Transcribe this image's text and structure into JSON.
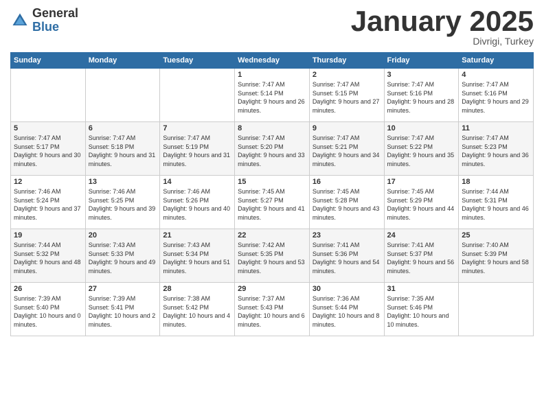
{
  "logo": {
    "general": "General",
    "blue": "Blue"
  },
  "header": {
    "title": "January 2025",
    "location": "Divrigi, Turkey"
  },
  "weekdays": [
    "Sunday",
    "Monday",
    "Tuesday",
    "Wednesday",
    "Thursday",
    "Friday",
    "Saturday"
  ],
  "weeks": [
    [
      {
        "day": "",
        "sunrise": "",
        "sunset": "",
        "daylight": ""
      },
      {
        "day": "",
        "sunrise": "",
        "sunset": "",
        "daylight": ""
      },
      {
        "day": "",
        "sunrise": "",
        "sunset": "",
        "daylight": ""
      },
      {
        "day": "1",
        "sunrise": "Sunrise: 7:47 AM",
        "sunset": "Sunset: 5:14 PM",
        "daylight": "Daylight: 9 hours and 26 minutes."
      },
      {
        "day": "2",
        "sunrise": "Sunrise: 7:47 AM",
        "sunset": "Sunset: 5:15 PM",
        "daylight": "Daylight: 9 hours and 27 minutes."
      },
      {
        "day": "3",
        "sunrise": "Sunrise: 7:47 AM",
        "sunset": "Sunset: 5:16 PM",
        "daylight": "Daylight: 9 hours and 28 minutes."
      },
      {
        "day": "4",
        "sunrise": "Sunrise: 7:47 AM",
        "sunset": "Sunset: 5:16 PM",
        "daylight": "Daylight: 9 hours and 29 minutes."
      }
    ],
    [
      {
        "day": "5",
        "sunrise": "Sunrise: 7:47 AM",
        "sunset": "Sunset: 5:17 PM",
        "daylight": "Daylight: 9 hours and 30 minutes."
      },
      {
        "day": "6",
        "sunrise": "Sunrise: 7:47 AM",
        "sunset": "Sunset: 5:18 PM",
        "daylight": "Daylight: 9 hours and 31 minutes."
      },
      {
        "day": "7",
        "sunrise": "Sunrise: 7:47 AM",
        "sunset": "Sunset: 5:19 PM",
        "daylight": "Daylight: 9 hours and 31 minutes."
      },
      {
        "day": "8",
        "sunrise": "Sunrise: 7:47 AM",
        "sunset": "Sunset: 5:20 PM",
        "daylight": "Daylight: 9 hours and 33 minutes."
      },
      {
        "day": "9",
        "sunrise": "Sunrise: 7:47 AM",
        "sunset": "Sunset: 5:21 PM",
        "daylight": "Daylight: 9 hours and 34 minutes."
      },
      {
        "day": "10",
        "sunrise": "Sunrise: 7:47 AM",
        "sunset": "Sunset: 5:22 PM",
        "daylight": "Daylight: 9 hours and 35 minutes."
      },
      {
        "day": "11",
        "sunrise": "Sunrise: 7:47 AM",
        "sunset": "Sunset: 5:23 PM",
        "daylight": "Daylight: 9 hours and 36 minutes."
      }
    ],
    [
      {
        "day": "12",
        "sunrise": "Sunrise: 7:46 AM",
        "sunset": "Sunset: 5:24 PM",
        "daylight": "Daylight: 9 hours and 37 minutes."
      },
      {
        "day": "13",
        "sunrise": "Sunrise: 7:46 AM",
        "sunset": "Sunset: 5:25 PM",
        "daylight": "Daylight: 9 hours and 39 minutes."
      },
      {
        "day": "14",
        "sunrise": "Sunrise: 7:46 AM",
        "sunset": "Sunset: 5:26 PM",
        "daylight": "Daylight: 9 hours and 40 minutes."
      },
      {
        "day": "15",
        "sunrise": "Sunrise: 7:45 AM",
        "sunset": "Sunset: 5:27 PM",
        "daylight": "Daylight: 9 hours and 41 minutes."
      },
      {
        "day": "16",
        "sunrise": "Sunrise: 7:45 AM",
        "sunset": "Sunset: 5:28 PM",
        "daylight": "Daylight: 9 hours and 43 minutes."
      },
      {
        "day": "17",
        "sunrise": "Sunrise: 7:45 AM",
        "sunset": "Sunset: 5:29 PM",
        "daylight": "Daylight: 9 hours and 44 minutes."
      },
      {
        "day": "18",
        "sunrise": "Sunrise: 7:44 AM",
        "sunset": "Sunset: 5:31 PM",
        "daylight": "Daylight: 9 hours and 46 minutes."
      }
    ],
    [
      {
        "day": "19",
        "sunrise": "Sunrise: 7:44 AM",
        "sunset": "Sunset: 5:32 PM",
        "daylight": "Daylight: 9 hours and 48 minutes."
      },
      {
        "day": "20",
        "sunrise": "Sunrise: 7:43 AM",
        "sunset": "Sunset: 5:33 PM",
        "daylight": "Daylight: 9 hours and 49 minutes."
      },
      {
        "day": "21",
        "sunrise": "Sunrise: 7:43 AM",
        "sunset": "Sunset: 5:34 PM",
        "daylight": "Daylight: 9 hours and 51 minutes."
      },
      {
        "day": "22",
        "sunrise": "Sunrise: 7:42 AM",
        "sunset": "Sunset: 5:35 PM",
        "daylight": "Daylight: 9 hours and 53 minutes."
      },
      {
        "day": "23",
        "sunrise": "Sunrise: 7:41 AM",
        "sunset": "Sunset: 5:36 PM",
        "daylight": "Daylight: 9 hours and 54 minutes."
      },
      {
        "day": "24",
        "sunrise": "Sunrise: 7:41 AM",
        "sunset": "Sunset: 5:37 PM",
        "daylight": "Daylight: 9 hours and 56 minutes."
      },
      {
        "day": "25",
        "sunrise": "Sunrise: 7:40 AM",
        "sunset": "Sunset: 5:39 PM",
        "daylight": "Daylight: 9 hours and 58 minutes."
      }
    ],
    [
      {
        "day": "26",
        "sunrise": "Sunrise: 7:39 AM",
        "sunset": "Sunset: 5:40 PM",
        "daylight": "Daylight: 10 hours and 0 minutes."
      },
      {
        "day": "27",
        "sunrise": "Sunrise: 7:39 AM",
        "sunset": "Sunset: 5:41 PM",
        "daylight": "Daylight: 10 hours and 2 minutes."
      },
      {
        "day": "28",
        "sunrise": "Sunrise: 7:38 AM",
        "sunset": "Sunset: 5:42 PM",
        "daylight": "Daylight: 10 hours and 4 minutes."
      },
      {
        "day": "29",
        "sunrise": "Sunrise: 7:37 AM",
        "sunset": "Sunset: 5:43 PM",
        "daylight": "Daylight: 10 hours and 6 minutes."
      },
      {
        "day": "30",
        "sunrise": "Sunrise: 7:36 AM",
        "sunset": "Sunset: 5:44 PM",
        "daylight": "Daylight: 10 hours and 8 minutes."
      },
      {
        "day": "31",
        "sunrise": "Sunrise: 7:35 AM",
        "sunset": "Sunset: 5:46 PM",
        "daylight": "Daylight: 10 hours and 10 minutes."
      },
      {
        "day": "",
        "sunrise": "",
        "sunset": "",
        "daylight": ""
      }
    ]
  ]
}
